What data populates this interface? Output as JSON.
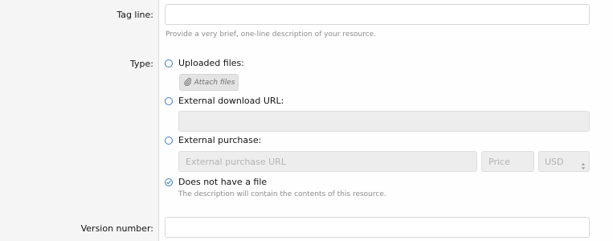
{
  "form": {
    "tag_line": {
      "label": "Tag line:",
      "value": "",
      "hint": "Provide a very brief, one-line description of your resource."
    },
    "type": {
      "label": "Type:",
      "options": [
        {
          "label": "Uploaded files:",
          "checked": false
        },
        {
          "label": "External download URL:",
          "checked": false
        },
        {
          "label": "External purchase:",
          "checked": false
        },
        {
          "label": "Does not have a file",
          "checked": true,
          "hint": "The description will contain the contents of this resource."
        }
      ],
      "attach_button": "Attach files",
      "download_url_value": "",
      "purchase_url_placeholder": "External purchase URL",
      "price_placeholder": "Price",
      "currency_selected": "USD"
    },
    "version_number": {
      "label": "Version number:",
      "value": ""
    }
  },
  "colors": {
    "radio_accent": "#3d7dbf",
    "label_column_bg": "#f5f5f5",
    "form_bg": "#fefefe",
    "disabled_bg": "#ededed"
  }
}
